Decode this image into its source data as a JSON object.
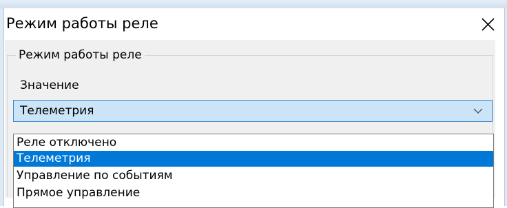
{
  "window": {
    "title": "Режим работы реле",
    "close_icon": "close-icon"
  },
  "group": {
    "title": "Режим работы реле",
    "field_label": "Значение"
  },
  "combo": {
    "selected_value": "Телеметрия",
    "arrow_icon": "chevron-down-icon"
  },
  "dropdown": {
    "options": [
      {
        "label": "Реле отключено",
        "selected": false
      },
      {
        "label": "Телеметрия",
        "selected": true
      },
      {
        "label": "Управление по событиям",
        "selected": false
      },
      {
        "label": "Прямое управление",
        "selected": false
      }
    ]
  },
  "colors": {
    "selection": "#0078d7",
    "combo_background": "#cce4f7",
    "combo_border": "#3d88d0",
    "client_background": "#f0f0f0"
  }
}
